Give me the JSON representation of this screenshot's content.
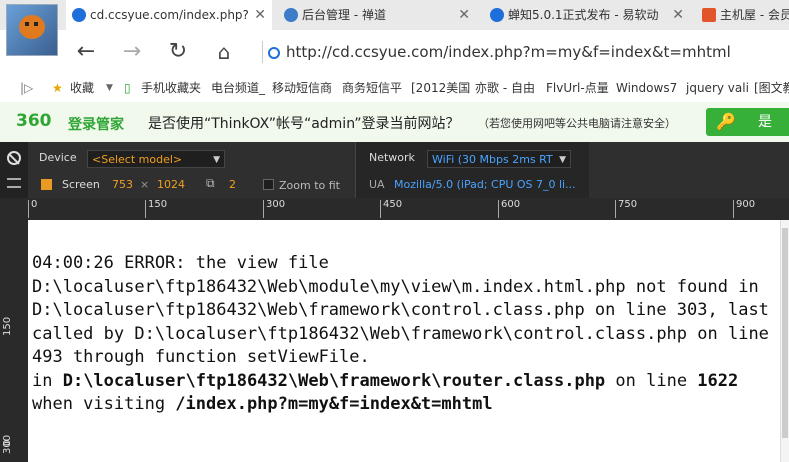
{
  "tabs": [
    {
      "label": "cd.ccsyue.com/index.php?",
      "active": true
    },
    {
      "label": "后台管理 - 禅道",
      "active": false
    },
    {
      "label": "蝉知5.0.1正式发布 - 易软动",
      "active": false
    },
    {
      "label": "主机屋 - 会员",
      "active": false
    }
  ],
  "nav": {
    "url": "http://cd.ccsyue.com/index.php?m=my&f=index&t=mhtml"
  },
  "bookmarks": {
    "items": [
      "收藏",
      "手机收藏夹",
      "电台频道_",
      "移动短信商",
      "商务短信平",
      "[2012美国",
      "亦歌 - 自由",
      "FlvUrl-点量",
      "Windows7",
      "jquery vali",
      "[图文教"
    ]
  },
  "banner": {
    "logo_360": "360",
    "logo_text": "登录管家",
    "question": "是否使用“ThinkOX”帐号“admin”登录当前网站？",
    "note": "（若您使用网吧等公共电脑请注意安全）",
    "yes_label": "是"
  },
  "devtools": {
    "device_label": "Device",
    "device_select": "<Select model>",
    "screen_label": "Screen",
    "width": "753",
    "times": "×",
    "height": "1024",
    "dpr": "2",
    "zoom_label": "Zoom to fit",
    "network_label": "Network",
    "network_select": "WiFi (30 Mbps 2ms RT",
    "ua_label": "UA",
    "ua_value": "Mozilla/5.0 (iPad; CPU OS 7_0 li..."
  },
  "ruler": {
    "top_labels": [
      "0",
      "150",
      "300",
      "450",
      "600",
      "750",
      "900"
    ],
    "left_labels": [
      "0",
      "150",
      "300"
    ]
  },
  "error": {
    "line1": "04:00:26 ERROR: the view file",
    "line2": "D:\\localuser\\ftp186432\\Web\\module\\my\\view\\m.index.html.php not found in",
    "line3": "D:\\localuser\\ftp186432\\Web\\framework\\control.class.php on line 303, last",
    "line4": "called by D:\\localuser\\ftp186432\\Web\\framework\\control.class.php on line",
    "line5": "493 through function setViewFile.",
    "line6_prefix": "in ",
    "line6_file": "D:\\localuser\\ftp186432\\Web\\framework\\router.class.php",
    "line6_mid": " on line ",
    "line6_num": "1622",
    "line7_prefix": "when visiting ",
    "line7_url": "/index.php?m=my&f=index&t=mhtml"
  }
}
